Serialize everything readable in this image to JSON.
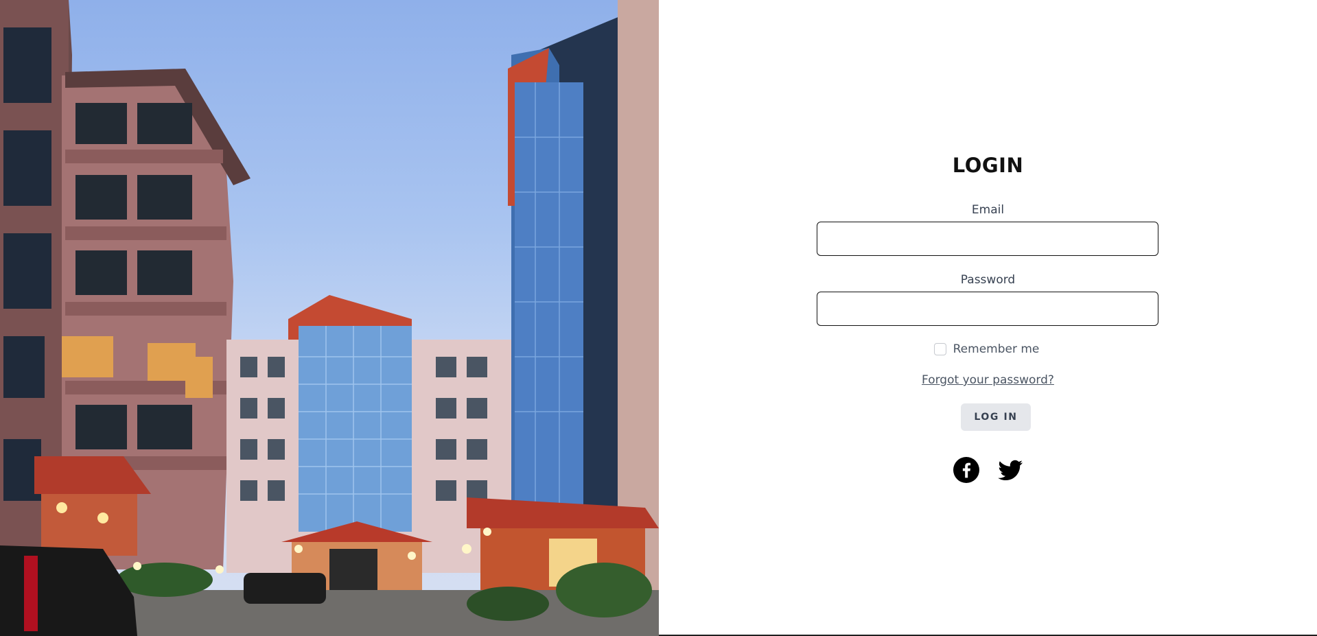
{
  "login": {
    "title": "LOGIN",
    "email_label": "Email",
    "email_value": "",
    "password_label": "Password",
    "password_value": "",
    "remember_label": "Remember me",
    "remember_checked": false,
    "forgot_link": "Forgot your password?",
    "submit_label": "LOG IN"
  },
  "social": [
    {
      "icon": "facebook-icon"
    },
    {
      "icon": "twitter-icon"
    }
  ],
  "colors": {
    "text_primary": "#111111",
    "text_muted": "#4b5563",
    "button_bg": "#e5e7eb",
    "border": "#111111"
  }
}
